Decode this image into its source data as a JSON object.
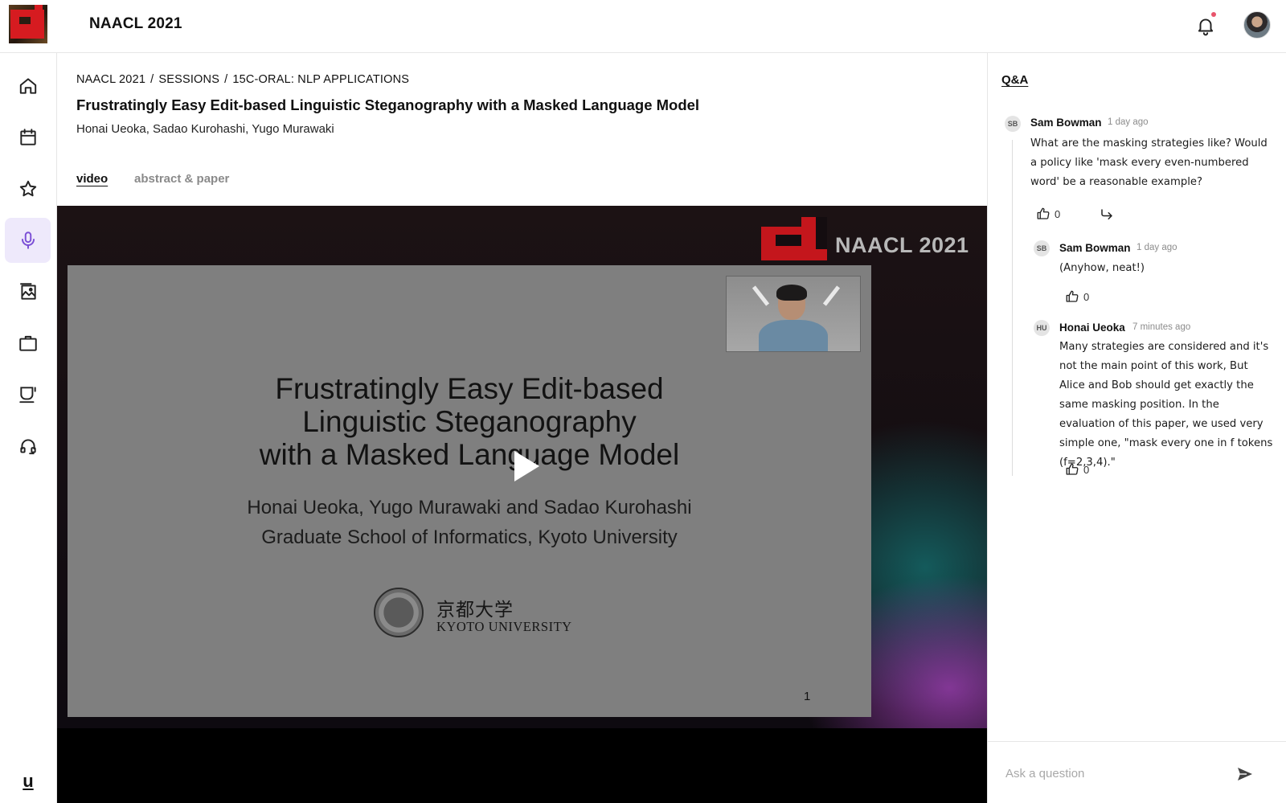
{
  "header": {
    "app_title": "NAACL 2021",
    "icons": {
      "logo": "naacl-logo",
      "notifications": "bell-icon",
      "profile": "user-avatar"
    },
    "notification_dot_color": "#e8546b"
  },
  "sidebar": {
    "items": [
      {
        "icon": "home-icon"
      },
      {
        "icon": "calendar-icon"
      },
      {
        "icon": "star-icon"
      },
      {
        "icon": "microphone-icon",
        "active": true
      },
      {
        "icon": "image-gallery-icon"
      },
      {
        "icon": "briefcase-icon"
      },
      {
        "icon": "coffee-cup-icon"
      },
      {
        "icon": "headphones-icon"
      }
    ],
    "footer_logo": "u",
    "active_color": "#7b4fd6"
  },
  "breadcrumb": {
    "items": [
      "NAACL 2021",
      "SESSIONS",
      "15C-ORAL: NLP APPLICATIONS"
    ],
    "separator": "/"
  },
  "paper": {
    "title": "Frustratingly Easy Edit-based Linguistic Steganography with a Masked Language Model",
    "authors": "Honai Ueoka, Sadao Kurohashi, Yugo Murawaki"
  },
  "tabs": [
    {
      "label": "video",
      "active": true
    },
    {
      "label": "abstract & paper",
      "active": false
    }
  ],
  "video": {
    "conference_mark": "NAACL 2021",
    "slide": {
      "title_lines": [
        "Frustratingly Easy Edit-based",
        "Linguistic Steganography",
        "with a Masked Language Model"
      ],
      "author_lines": [
        "Honai Ueoka, Yugo Murawaki and Sadao Kurohashi",
        "Graduate School of Informatics, Kyoto University"
      ],
      "university_jp": "京都大学",
      "university_en": "KYOTO UNIVERSITY",
      "page_number": "1"
    },
    "play_icon": "play-icon"
  },
  "qa": {
    "title": "Q&A",
    "comments": [
      {
        "initials": "SB",
        "name": "Sam Bowman",
        "time": "1 day ago",
        "text": "What are the masking strategies like? Would a policy like 'mask every  even-numbered word' be a reasonable example?",
        "likes": "0"
      },
      {
        "initials": "SB",
        "name": "Sam Bowman",
        "time": "1 day ago",
        "text": "(Anyhow, neat!)",
        "likes": "0"
      },
      {
        "initials": "HU",
        "name": "Honai Ueoka",
        "time": "7 minutes ago",
        "text": "Many strategies are considered and it's not the main point of this work,  But Alice and Bob should get exactly the same masking position. In the evaluation of this paper, we used very simple one, \"mask every one in f tokens (f=2,3,4).\"",
        "likes": "0"
      }
    ],
    "ask_placeholder": "Ask a question",
    "icons": {
      "like": "thumbs-up-icon",
      "reply": "reply-arrow-icon",
      "send": "send-icon"
    }
  }
}
